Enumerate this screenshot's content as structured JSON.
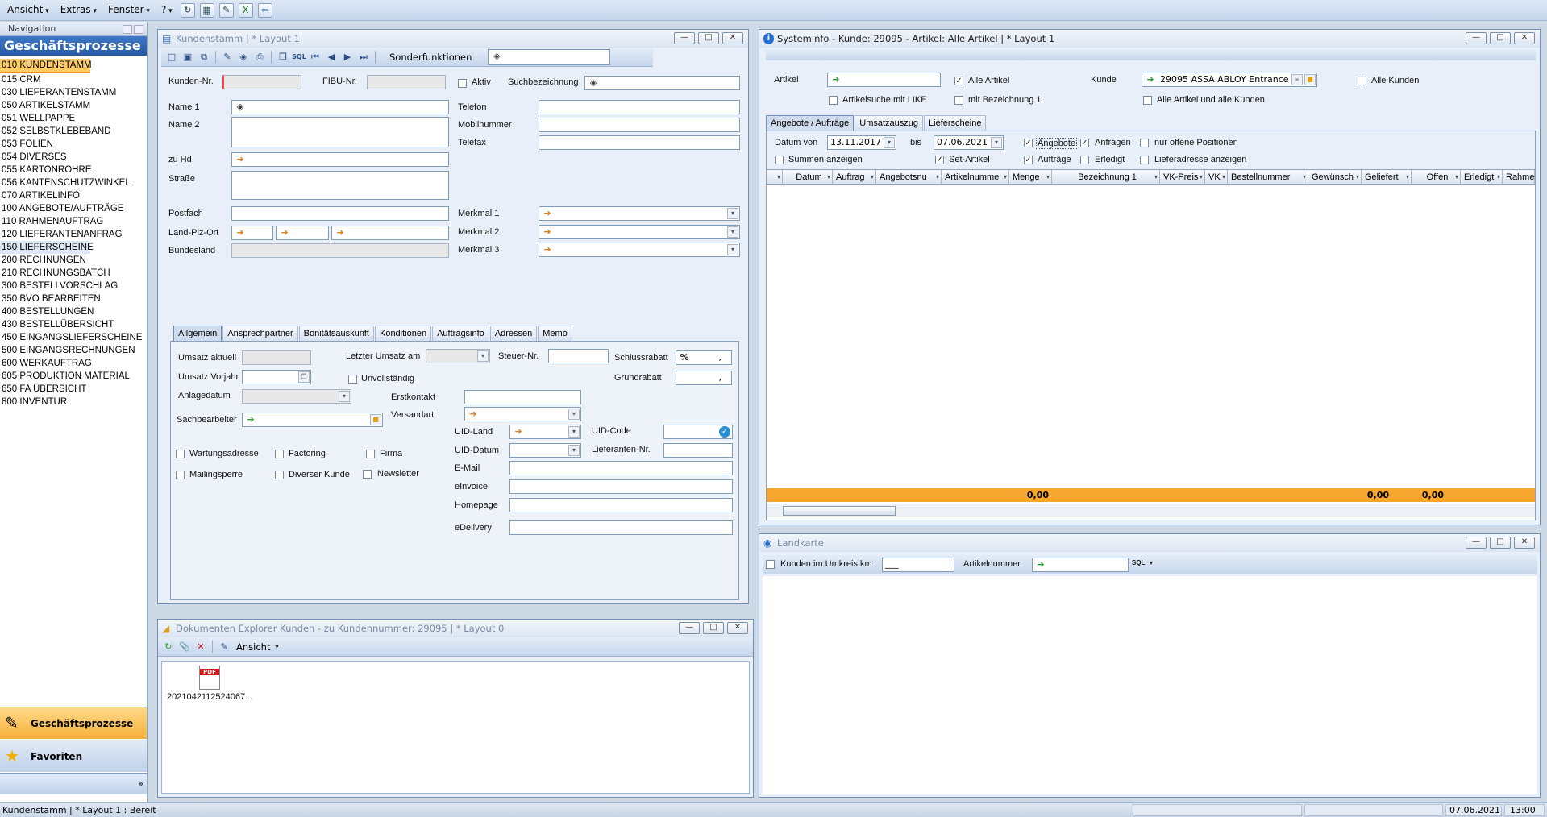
{
  "menu": {
    "items": [
      "Ansicht",
      "Extras",
      "Fenster",
      "?"
    ]
  },
  "nav": {
    "header": "Navigation",
    "title": "Geschäftsprozesse",
    "items": [
      "010 KUNDENSTAMM",
      "015 CRM",
      "030 LIEFERANTENSTAMM",
      "050 ARTIKELSTAMM",
      "051 WELLPAPPE",
      "052 SELBSTKLEBEBAND",
      "053 FOLIEN",
      "054 DIVERSES",
      "055 KARTONROHRE",
      "056 KANTENSCHUTZWINKEL",
      "070 ARTIKELINFO",
      "100 ANGEBOTE/AUFTRÄGE",
      "110 RAHMENAUFTRAG",
      "120 LIEFERANTENANFRAG",
      "150 LIEFERSCHEINE",
      "200 RECHNUNGEN",
      "210 RECHNUNGSBATCH",
      "300 BESTELLVORSCHLAG",
      "350 BVO BEARBEITEN",
      "400 BESTELLUNGEN",
      "430 BESTELLÜBERSICHT",
      "450 EINGANGSLIEFERSCHEINE",
      "500 EINGANGSRECHNUNGEN",
      "600 WERKAUFTRAG",
      "605 PRODUKTION MATERIAL",
      "650 FA ÜBERSICHT",
      "800 INVENTUR"
    ],
    "bottom_buttons": [
      "Geschäftsprozesse",
      "Favoriten"
    ]
  },
  "kunden": {
    "title": "Kundenstamm | * Layout 1",
    "sonderfunktionen": "Sonderfunktionen",
    "labels": {
      "kundennr": "Kunden-Nr.",
      "fibu": "FIBU-Nr.",
      "aktiv": "Aktiv",
      "such": "Suchbezeichnung",
      "name1": "Name 1",
      "name2": "Name 2",
      "zuhd": "zu Hd.",
      "strasse": "Straße",
      "postfach": "Postfach",
      "lpo": "Land-Plz-Ort",
      "bundesland": "Bundesland",
      "telefon": "Telefon",
      "mobil": "Mobilnummer",
      "telefax": "Telefax",
      "merkmal1": "Merkmal 1",
      "merkmal2": "Merkmal 2",
      "merkmal3": "Merkmal 3"
    },
    "tabs": [
      "Allgemein",
      "Ansprechpartner",
      "Bonitätsauskunft",
      "Konditionen",
      "Auftragsinfo",
      "Adressen",
      "Memo"
    ],
    "allgemein": {
      "umsatz_aktuell": "Umsatz aktuell",
      "letzter_umsatz": "Letzter Umsatz am",
      "steuer": "Steuer-Nr.",
      "schlussrabatt": "Schlussrabatt",
      "schlussrabatt_val": ",",
      "umsatz_vorjahr": "Umsatz Vorjahr",
      "unvollstaendig": "Unvollständig",
      "grundrabatt": "Grundrabatt",
      "grundrabatt_val": ",",
      "anlagedatum": "Anlagedatum",
      "erstkontakt": "Erstkontakt",
      "versandart": "Versandart",
      "sachbearbeiter": "Sachbearbeiter",
      "uidland": "UID-Land",
      "uidcode": "UID-Code",
      "uiddatum": "UID-Datum",
      "lieferantennr": "Lieferanten-Nr.",
      "email": "E-Mail",
      "einvoice": "eInvoice",
      "homepage": "Homepage",
      "edelivery": "eDelivery",
      "wartung": "Wartungsadresse",
      "factoring": "Factoring",
      "firma": "Firma",
      "mailing": "Mailingsperre",
      "diverser": "Diverser Kunde",
      "newsletter": "Newsletter"
    }
  },
  "doc": {
    "title": "Dokumenten Explorer Kunden  -  zu Kundennummer: 29095 | * Layout 0",
    "ansicht": "Ansicht",
    "file": "2021042112524067...",
    "file_type": "PDF"
  },
  "sys": {
    "title": "Systeminfo  -  Kunde: 29095 - Artikel: Alle Artikel | * Layout 1",
    "artikel": "Artikel",
    "alle_artikel": "Alle Artikel",
    "kunde": "Kunde",
    "kunde_val": "29095 ASSA ABLOY Entrance",
    "alle_kunden": "Alle Kunden",
    "like": "Artikelsuche mit LIKE",
    "mitbez": "mit Bezeichnung 1",
    "alleartkunden": "Alle Artikel und alle Kunden",
    "tabs": [
      "Angebote / Aufträge",
      "Umsatzauszug",
      "Lieferscheine"
    ],
    "datum_von": "Datum von",
    "von_val": "13.11.2017",
    "bis": "bis",
    "bis_val": "07.06.2021",
    "angebote": "Angebote",
    "anfragen": "Anfragen",
    "nur_offen": "nur offene Positionen",
    "summen": "Summen anzeigen",
    "set": "Set-Artikel",
    "auftraege": "Aufträge",
    "erledigt": "Erledigt",
    "lieferadr": "Lieferadresse anzeigen",
    "columns": [
      "Datum",
      "Auftrag",
      "Angebotsnu",
      "Artikelnumme",
      "Menge",
      "Bezeichnung 1",
      "VK-Preis",
      "VK",
      "Bestellnummer",
      "Gewünsch",
      "Geliefert",
      "Offen",
      "Erledigt",
      "Rahmen"
    ],
    "sums": [
      "0,00",
      "0,00",
      "0,00"
    ]
  },
  "land": {
    "title": "Landkarte",
    "umkreis": "Kunden im Umkreis  km",
    "km_val": "___",
    "artikelnr": "Artikelnummer",
    "sql": "SQL"
  },
  "status": {
    "text": "Kundenstamm | * Layout 1 : Bereit",
    "date": "07.06.2021",
    "time": "13:00"
  }
}
